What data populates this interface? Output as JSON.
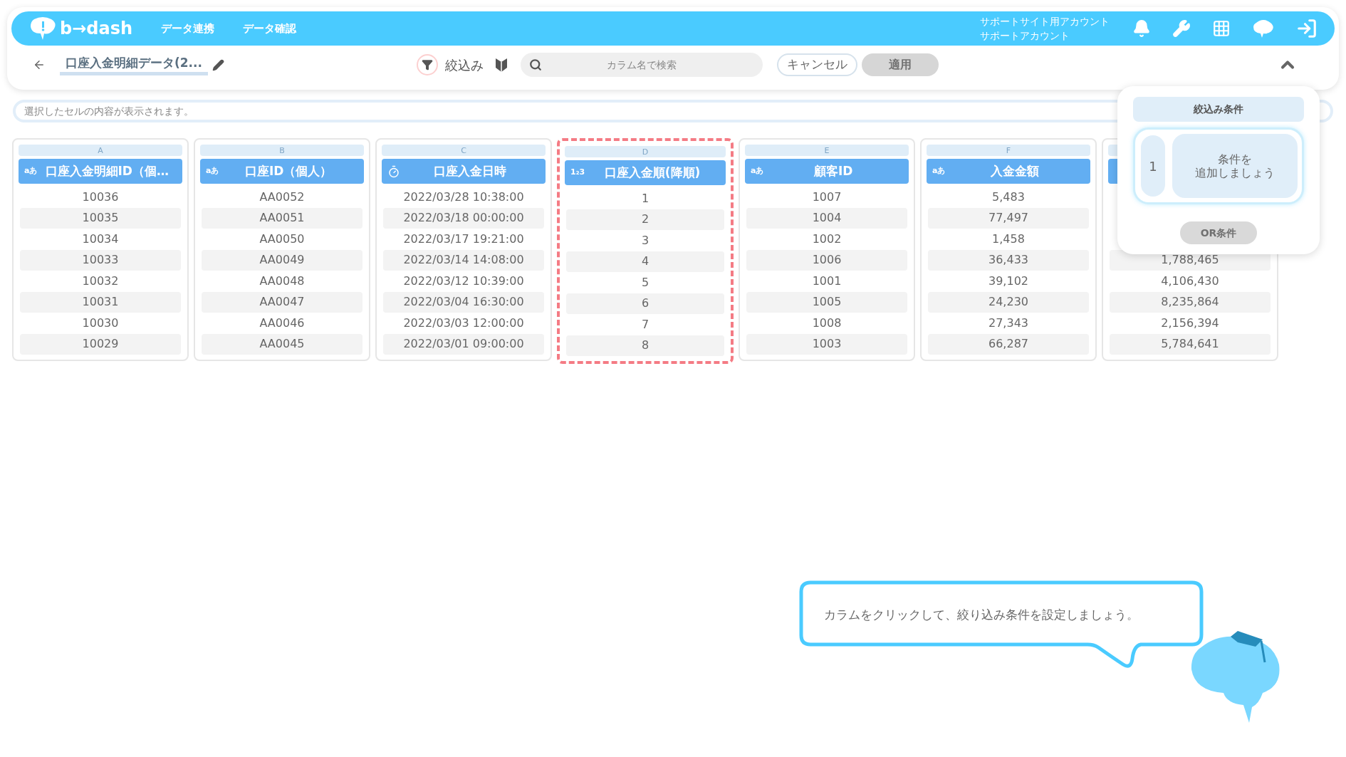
{
  "header": {
    "logo": "b→dash",
    "nav": [
      "データ連携",
      "データ確認"
    ],
    "account": [
      "サポートサイト用アカウント",
      "サポートアカウント"
    ]
  },
  "toolbar": {
    "title": "口座入金明細データ(2...",
    "filter_label": "絞込み",
    "search": {
      "placeholder": "カラム名で検索"
    },
    "cancel": "キャンセル",
    "apply": {
      "label": "適用",
      "disabled": true
    }
  },
  "cell_viewer": {
    "placeholder": "選択したセルの内容が表示されます。"
  },
  "columns": [
    {
      "letter": "A",
      "kind": "text",
      "type_label": "aあ",
      "title": "口座入金明細ID（個…",
      "highlighted": false,
      "values": [
        "10036",
        "10035",
        "10034",
        "10033",
        "10032",
        "10031",
        "10030",
        "10029"
      ]
    },
    {
      "letter": "B",
      "kind": "text",
      "type_label": "aあ",
      "title": "口座ID（個人）",
      "highlighted": false,
      "values": [
        "AA0052",
        "AA0051",
        "AA0050",
        "AA0049",
        "AA0048",
        "AA0047",
        "AA0046",
        "AA0045"
      ]
    },
    {
      "letter": "C",
      "kind": "datetime",
      "title": "口座入金日時",
      "highlighted": false,
      "values": [
        "2022/03/28 10:38:00",
        "2022/03/18 00:00:00",
        "2022/03/17 19:21:00",
        "2022/03/14 14:08:00",
        "2022/03/12 10:39:00",
        "2022/03/04 16:30:00",
        "2022/03/03 12:00:00",
        "2022/03/01 09:00:00"
      ]
    },
    {
      "letter": "D",
      "kind": "number",
      "type_label": "1₂3",
      "title": "口座入金順(降順)",
      "highlighted": true,
      "values": [
        "1",
        "2",
        "3",
        "4",
        "5",
        "6",
        "7",
        "8"
      ]
    },
    {
      "letter": "E",
      "kind": "text",
      "type_label": "aあ",
      "title": "顧客ID",
      "highlighted": false,
      "values": [
        "1007",
        "1004",
        "1002",
        "1006",
        "1001",
        "1005",
        "1008",
        "1003"
      ]
    },
    {
      "letter": "F",
      "kind": "text",
      "type_label": "aあ",
      "title": "入金金額",
      "highlighted": false,
      "values": [
        "5,483",
        "77,497",
        "1,458",
        "36,433",
        "39,102",
        "24,230",
        "27,343",
        "66,287"
      ]
    },
    {
      "kind": "text",
      "highlighted": false,
      "values": [
        "1,788,465",
        "4,106,430",
        "8,235,864",
        "2,156,394",
        "5,784,641"
      ]
    }
  ],
  "filter_panel": {
    "title": "絞込み条件",
    "groups": [
      {
        "number": "1",
        "hint": [
          "条件を",
          "追加しましょう"
        ]
      }
    ],
    "or_button": "OR条件"
  },
  "tip": {
    "text": "カラムをクリックして、絞り込み条件を設定しましょう。"
  }
}
